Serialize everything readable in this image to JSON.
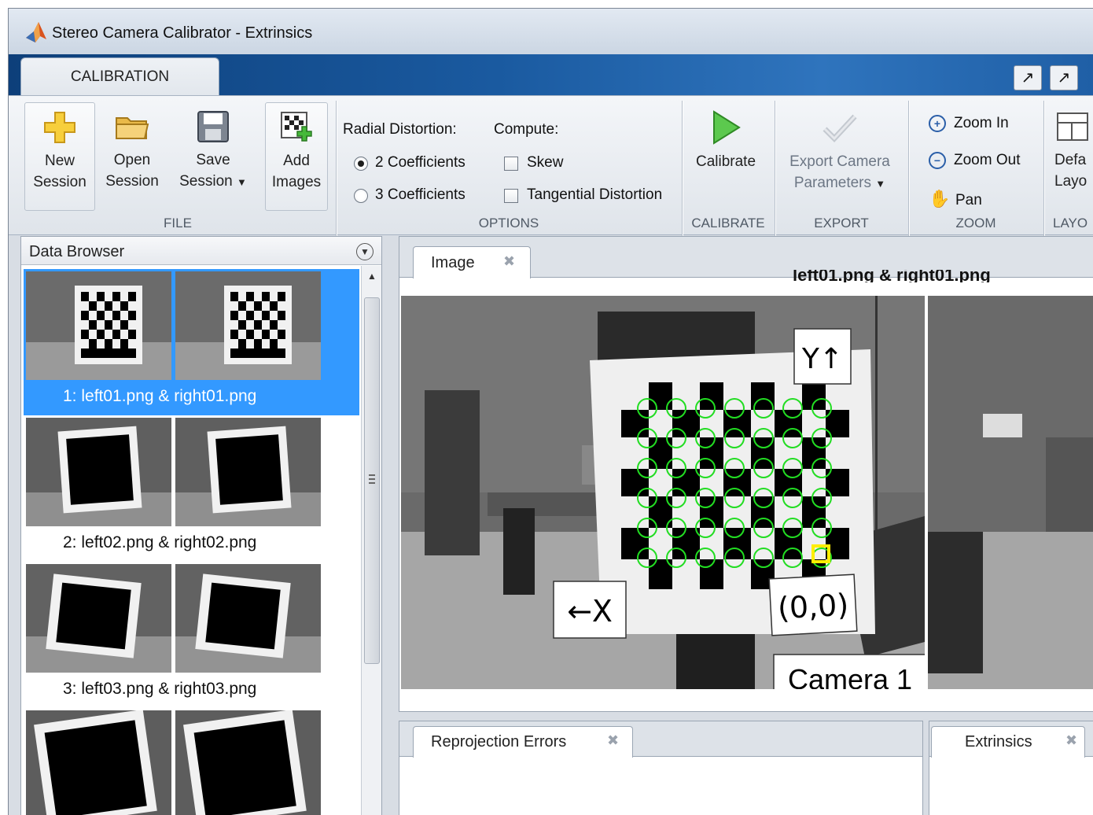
{
  "window": {
    "title": "Stereo Camera Calibrator - Extrinsics"
  },
  "ribbon": {
    "tab_label": "CALIBRATION",
    "file": {
      "group_label": "FILE",
      "new_line1": "New",
      "new_line2": "Session",
      "open_line1": "Open",
      "open_line2": "Session",
      "save_line1": "Save",
      "save_line2": "Session",
      "add_line1": "Add",
      "add_line2": "Images"
    },
    "options": {
      "group_label": "OPTIONS",
      "radial_label": "Radial Distortion:",
      "compute_label": "Compute:",
      "coeff2": "2 Coefficients",
      "coeff3": "3 Coefficients",
      "skew": "Skew",
      "tangential": "Tangential Distortion",
      "selected_coefficients": "2 Coefficients",
      "skew_checked": false,
      "tangential_checked": false
    },
    "calibrate": {
      "group_label": "CALIBRATE",
      "button": "Calibrate"
    },
    "export": {
      "group_label": "EXPORT",
      "line1": "Export Camera",
      "line2": "Parameters"
    },
    "zoom": {
      "group_label": "ZOOM",
      "zoom_in": "Zoom In",
      "zoom_out": "Zoom Out",
      "pan": "Pan"
    },
    "layout": {
      "group_label": "LAYO",
      "line1": "Defa",
      "line2": "Layo"
    }
  },
  "data_browser": {
    "title": "Data Browser",
    "items": [
      {
        "caption": "1: left01.png & right01.png",
        "selected": true
      },
      {
        "caption": "2: left02.png & right02.png",
        "selected": false
      },
      {
        "caption": "3: left03.png & right03.png",
        "selected": false
      },
      {
        "caption": "",
        "selected": false
      }
    ]
  },
  "image_panel": {
    "tab_label": "Image",
    "title": "left01.png & right01.png",
    "labels": {
      "y_axis": "Y↑",
      "x_axis": "←X",
      "origin": "(0,0)",
      "camera": "Camera 1"
    }
  },
  "bottom_tabs": {
    "reprojection": "Reprojection Errors",
    "extrinsics": "Extrinsics"
  },
  "colors": {
    "accent": "#3399ff",
    "detected_points": "#22dd22",
    "origin_marker": "#ffee00",
    "ribbon_blue": "#1a5aa0"
  }
}
